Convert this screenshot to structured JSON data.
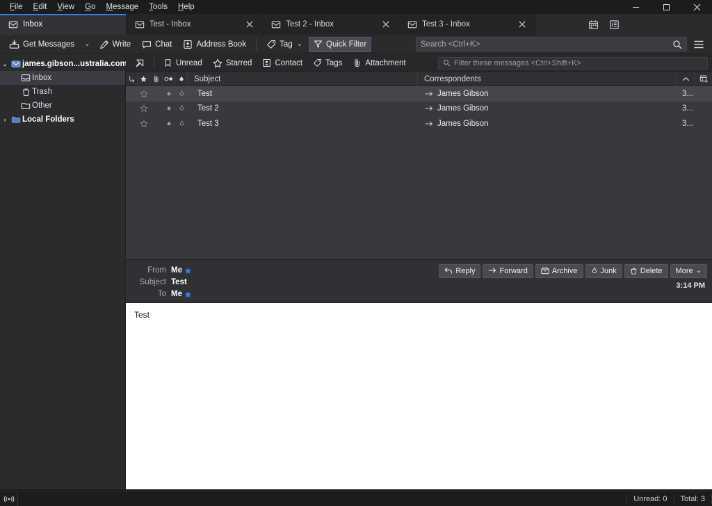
{
  "window": {
    "minimize_label": "–",
    "maximize_label": "□",
    "close_label": "✕"
  },
  "menubar": {
    "items": [
      {
        "label": "File",
        "accel": "F",
        "rest": "ile"
      },
      {
        "label": "Edit",
        "accel": "E",
        "rest": "dit"
      },
      {
        "label": "View",
        "accel": "V",
        "rest": "iew"
      },
      {
        "label": "Go",
        "accel": "G",
        "rest": "o"
      },
      {
        "label": "Message",
        "accel": "M",
        "rest": "essage"
      },
      {
        "label": "Tools",
        "accel": "T",
        "rest": "ools"
      },
      {
        "label": "Help",
        "accel": "H",
        "rest": "elp"
      }
    ]
  },
  "tabs": [
    {
      "label": "Inbox",
      "icon": "mail-icon",
      "active": true,
      "closable": false
    },
    {
      "label": "Test - Inbox",
      "icon": "mail-icon",
      "active": false,
      "closable": true
    },
    {
      "label": "Test 2 - Inbox",
      "icon": "mail-icon",
      "active": false,
      "closable": true
    },
    {
      "label": "Test 3 - Inbox",
      "icon": "mail-icon",
      "active": false,
      "closable": true
    }
  ],
  "tabbar_buttons": [
    {
      "name": "calendar-icon",
      "title": "Calendar"
    },
    {
      "name": "tasks-icon",
      "title": "Tasks"
    }
  ],
  "toolbar": {
    "get_messages_label": "Get Messages",
    "get_messages_chevron": "⌄",
    "write_label": "Write",
    "chat_label": "Chat",
    "address_book_label": "Address Book",
    "tag_label": "Tag",
    "tag_chevron": "⌄",
    "quick_filter_label": "Quick Filter",
    "quick_filter_active": true
  },
  "search": {
    "placeholder": "Search <Ctrl+K>",
    "value": ""
  },
  "folder_pane": {
    "account": {
      "label": "james.gibson...ustralia.com",
      "twisty": "⌄",
      "icon": "account-mail-icon"
    },
    "folders": [
      {
        "label": "Inbox",
        "icon": "inbox-icon",
        "selected": true
      },
      {
        "label": "Trash",
        "icon": "trash-icon",
        "selected": false
      },
      {
        "label": "Other",
        "icon": "folder-icon",
        "selected": false
      }
    ],
    "local_folders": {
      "label": "Local Folders",
      "twisty": "›",
      "icon": "folder-icon"
    }
  },
  "quick_filter": {
    "buttons": [
      {
        "label": "Unread",
        "icon": "bookmark-icon"
      },
      {
        "label": "Starred",
        "icon": "star-icon"
      },
      {
        "label": "Contact",
        "icon": "contact-icon"
      },
      {
        "label": "Tags",
        "icon": "tag-icon"
      },
      {
        "label": "Attachment",
        "icon": "paperclip-icon"
      }
    ],
    "pin_icon": "pin-filter-icon",
    "filter_placeholder": "Filter these messages <Ctrl+Shift+K>",
    "filter_value": ""
  },
  "message_list": {
    "columns": [
      {
        "key": "thread",
        "label": "",
        "icon": "thread-icon"
      },
      {
        "key": "star",
        "label": "",
        "icon": "star-icon"
      },
      {
        "key": "attachment",
        "label": "",
        "icon": "paperclip-icon"
      },
      {
        "key": "unread",
        "label": "",
        "icon": "unread-icon"
      },
      {
        "key": "junk",
        "label": "",
        "icon": "junk-flame-icon"
      },
      {
        "key": "subject",
        "label": "Subject"
      },
      {
        "key": "correspondents",
        "label": "Correspondents"
      }
    ],
    "sort_indicator": "⌃",
    "column_picker_icon": "column-picker-icon",
    "rows": [
      {
        "subject": "Test",
        "correspondent": "James Gibson",
        "direction": "outgoing",
        "date": "3...",
        "selected": true,
        "starred": false
      },
      {
        "subject": "Test 2",
        "correspondent": "James Gibson",
        "direction": "outgoing",
        "date": "3...",
        "selected": false,
        "starred": false
      },
      {
        "subject": "Test 3",
        "correspondent": "James Gibson",
        "direction": "outgoing",
        "date": "3...",
        "selected": false,
        "starred": false
      }
    ]
  },
  "message": {
    "from_label": "From",
    "from_value": "Me",
    "subject_label": "Subject",
    "subject_value": "Test",
    "to_label": "To",
    "to_value": "Me",
    "time": "3:14 PM",
    "body": "Test",
    "actions": [
      {
        "label": "Reply",
        "icon": "reply-icon"
      },
      {
        "label": "Forward",
        "icon": "forward-icon"
      },
      {
        "label": "Archive",
        "icon": "archive-icon"
      },
      {
        "label": "Junk",
        "icon": "junk-flame-icon"
      },
      {
        "label": "Delete",
        "icon": "trash-icon"
      },
      {
        "label": "More",
        "icon": "chevron-down-icon"
      }
    ],
    "more_chevron": "⌄"
  },
  "status_bar": {
    "connection_icon": "connection-icon",
    "unread_label": "Unread: 0",
    "total_label": "Total: 3"
  },
  "colors": {
    "accent": "#2f80ed",
    "window_bg": "#1c1c1e",
    "pane_bg": "#2b2b2e",
    "list_bg": "#38383d",
    "selected_row": "#46464e",
    "body_bg": "#ffffff"
  }
}
